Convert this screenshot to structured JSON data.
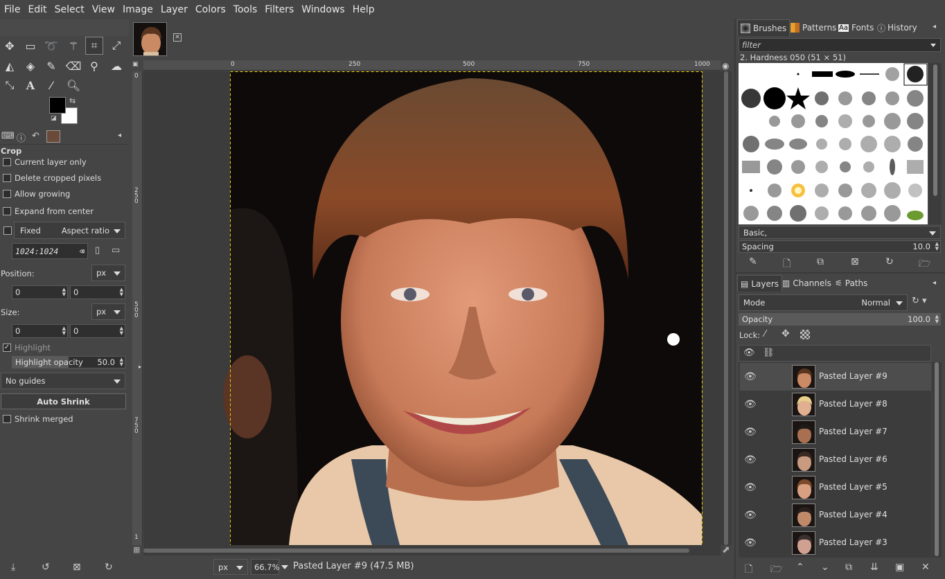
{
  "menu": [
    "File",
    "Edit",
    "Select",
    "View",
    "Image",
    "Layer",
    "Colors",
    "Tools",
    "Filters",
    "Windows",
    "Help"
  ],
  "tool_options": {
    "title": "Crop",
    "current_layer_only": "Current layer only",
    "delete_cropped": "Delete cropped pixels",
    "allow_growing": "Allow growing",
    "expand_from_center": "Expand from center",
    "fixed": "Fixed",
    "aspect_mode": "Aspect ratio",
    "aspect_value": "1024:1024",
    "position_label": "Position:",
    "position_unit": "px",
    "position_x": "0",
    "position_y": "0",
    "size_label": "Size:",
    "size_unit": "px",
    "size_w": "0",
    "size_h": "0",
    "highlight": "Highlight",
    "highlight_opacity_label": "Highlight opacity",
    "highlight_opacity_value": "50.0",
    "guides": "No guides",
    "auto_shrink": "Auto Shrink",
    "shrink_merged": "Shrink merged"
  },
  "ruler": {
    "h_ticks": [
      "0",
      "250",
      "500",
      "750",
      "1000"
    ],
    "v_ticks": [
      "0",
      "250",
      "500",
      "750",
      "1"
    ]
  },
  "status": {
    "unit": "px",
    "zoom": "66.7%",
    "layer_info": "Pasted Layer #9 (47.5 MB)"
  },
  "brushes": {
    "tabs": [
      "Brushes",
      "Patterns",
      "Fonts",
      "History"
    ],
    "filter_placeholder": "filter",
    "selected": "2. Hardness 050 (51 × 51)",
    "preset": "Basic,",
    "spacing_label": "Spacing",
    "spacing_value": "10.0"
  },
  "layers": {
    "tabs": [
      "Layers",
      "Channels",
      "Paths"
    ],
    "mode_label": "Mode",
    "mode_value": "Normal",
    "opacity_label": "Opacity",
    "opacity_value": "100.0",
    "lock_label": "Lock:",
    "items": [
      {
        "name": "Pasted Layer #9",
        "skin": "#c98a64",
        "hair": "#5a3520"
      },
      {
        "name": "Pasted Layer #8",
        "skin": "#e0b090",
        "hair": "#e8d08a"
      },
      {
        "name": "Pasted Layer #7",
        "skin": "#a87050",
        "hair": "#1e1a18"
      },
      {
        "name": "Pasted Layer #6",
        "skin": "#c89a80",
        "hair": "#3a2a22"
      },
      {
        "name": "Pasted Layer #5",
        "skin": "#d8a080",
        "hair": "#7a4a2a"
      },
      {
        "name": "Pasted Layer #4",
        "skin": "#c08a6a",
        "hair": "#2a2020"
      },
      {
        "name": "Pasted Layer #3",
        "skin": "#d0a090",
        "hair": "#3a3030"
      }
    ]
  },
  "colors": {
    "accent": "#dcdcdc",
    "canvas_bg": "#3c3c3c",
    "boundary": "#e8d000"
  }
}
